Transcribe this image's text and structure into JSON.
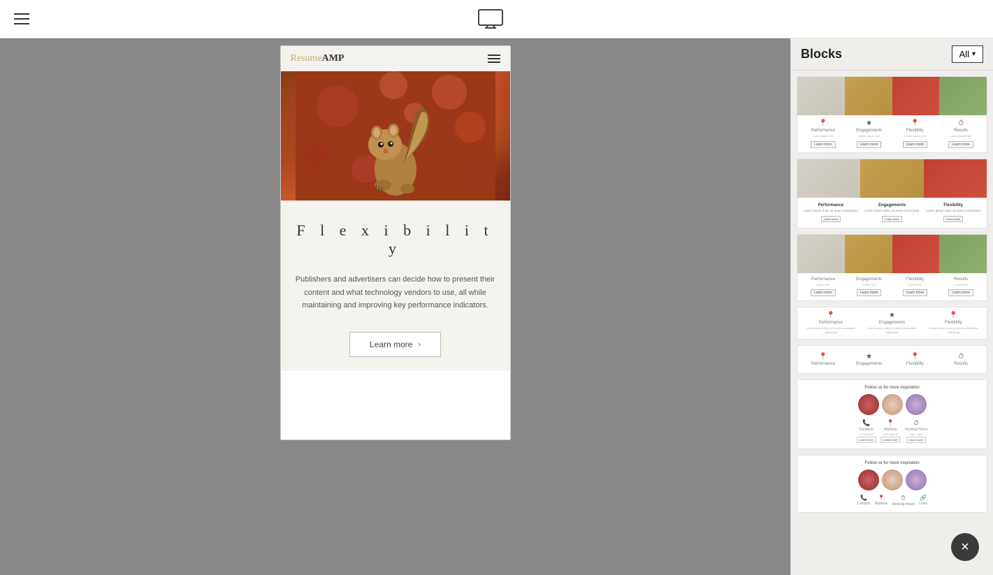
{
  "topbar": {
    "menu_icon": "hamburger-icon",
    "monitor_icon": "monitor-icon",
    "right_placeholder": ""
  },
  "sidebar": {
    "title": "Blocks",
    "all_button": "All",
    "dropdown_arrow": "▾",
    "blocks": [
      {
        "id": "block1",
        "type": "image-icons-4col",
        "icons": [
          "📍",
          "★",
          "📍",
          "⏱"
        ],
        "labels": [
          "Performance",
          "Engagements",
          "Flexibility",
          "Results"
        ]
      },
      {
        "id": "block2",
        "type": "image-text-3col",
        "labels": [
          "Performance",
          "Engagements",
          "Flexibility"
        ]
      },
      {
        "id": "block3",
        "type": "image-icons-4col-v2",
        "labels": [
          "Performance",
          "Engagements",
          "Flexibility",
          "Results"
        ]
      },
      {
        "id": "block4",
        "type": "icons-only-3col",
        "icons": [
          "📍",
          "★",
          "📍"
        ],
        "labels": [
          "Performance",
          "Engagements",
          "Flexibility"
        ]
      },
      {
        "id": "block5",
        "type": "icons-only-4col",
        "icons": [
          "📍",
          "★",
          "📍",
          "⏱"
        ],
        "labels": [
          "Performance",
          "Engagements",
          "Flexibility",
          "Results"
        ]
      },
      {
        "id": "block6",
        "type": "social-flowers",
        "title": "Follow us for more inspiration",
        "icons": [
          "📞",
          "📍",
          "⏱"
        ],
        "labels": [
          "Contacts",
          "Address",
          "Working Hours"
        ]
      },
      {
        "id": "block7",
        "type": "social-flowers-v2",
        "title": "Follow us for more inspiration",
        "icons": [
          "📞",
          "📍",
          "⏱",
          "🔗"
        ],
        "labels": [
          "Contacts",
          "Address",
          "Working Hours",
          "Links"
        ]
      }
    ]
  },
  "preview": {
    "logo_resume": "Resume",
    "logo_amp": "AMP",
    "section_title": "F l e x i b i l i t y",
    "description": "Publishers and advertisers can decide how to present their content and what technology vendors to use, all while maintaining and improving key performance indicators.",
    "button_label": "Learn more",
    "button_arrow": "›"
  },
  "close_button": "×"
}
